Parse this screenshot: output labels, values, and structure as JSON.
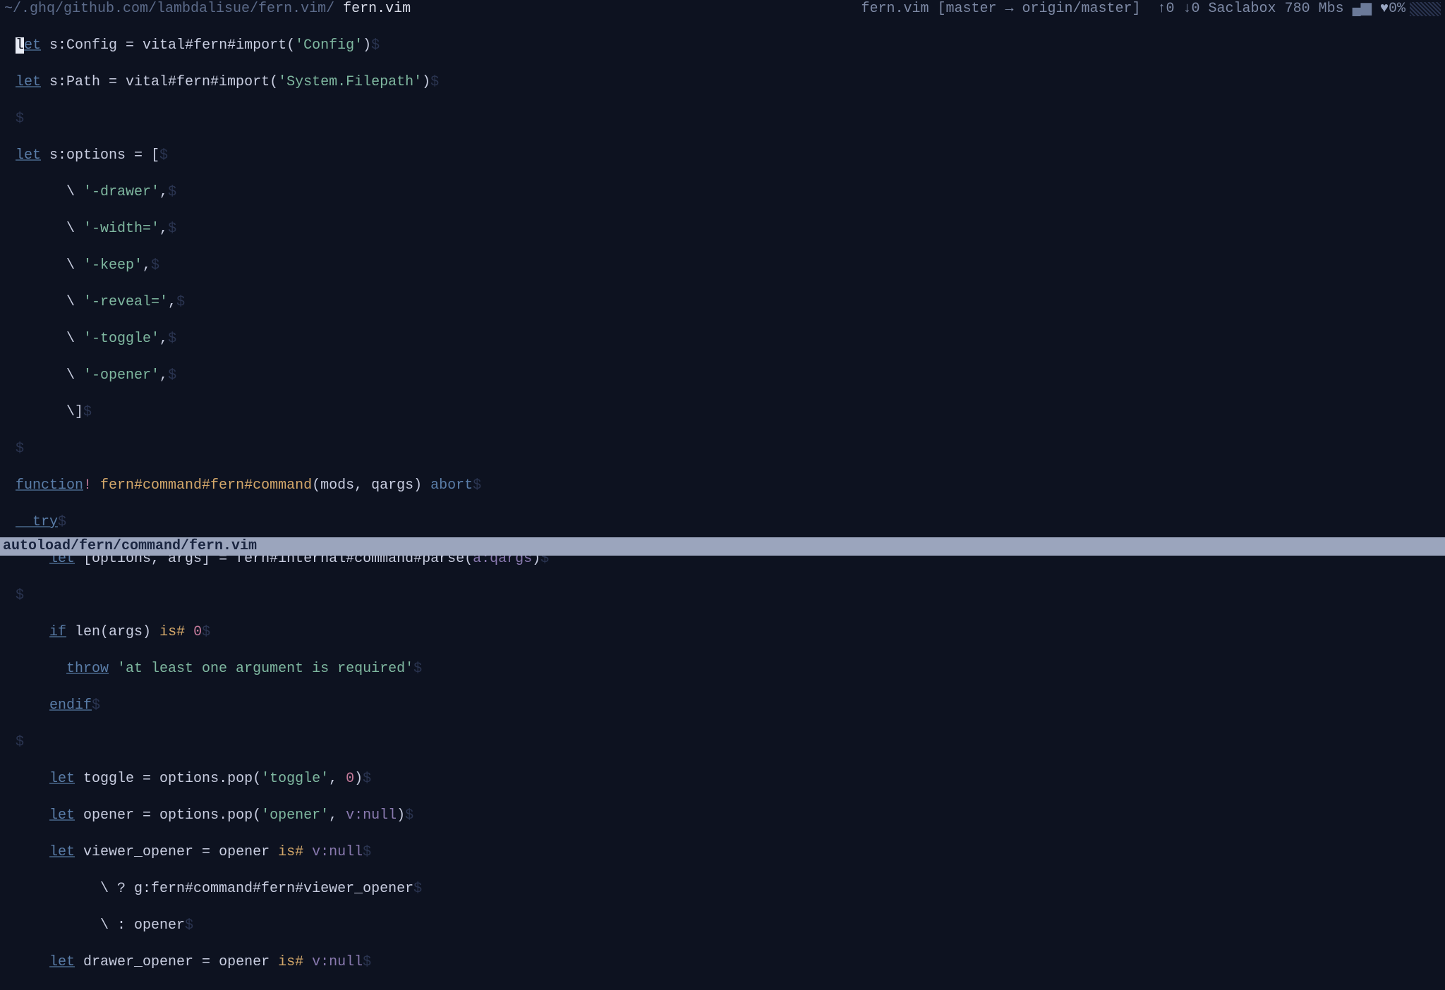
{
  "titlebar": {
    "path": "~/.ghq/github.com/lambdalisue/fern.vim/ ",
    "file": "fern.vim",
    "branch": "fern.vim [master → origin/master]",
    "arrows": "  ↑0 ↓0 ",
    "host": "Saclabox ",
    "net": "780 Mbs ",
    "signal_glyph": "▄▆",
    "heart": " ♥",
    "pct": "0%"
  },
  "eol": "$",
  "code": {
    "l1": {
      "kw": "let",
      "rest": " s:Config = vital#fern#import(",
      "str": "'Config'",
      "close": ")"
    },
    "l2": {
      "kw": "let",
      "rest": " s:Path = vital#fern#import(",
      "str": "'System.Filepath'",
      "close": ")"
    },
    "l4": {
      "kw": "let",
      "rest": " s:options = ["
    },
    "opts": [
      "'-drawer'",
      "'-width='",
      "'-keep'",
      "'-reveal='",
      "'-toggle'",
      "'-opener'"
    ],
    "optPrefix": "      \\ ",
    "optClose": "      \\]",
    "func": {
      "kw": "function",
      "bang": "!",
      "name": " fern#command#fern#command",
      "args": "(mods, qargs) ",
      "abort": "abort"
    },
    "try": "  try",
    "parse": {
      "pre": "    ",
      "kw": "let",
      "rest": " [options, args] = fern#internal#command#parse(",
      "arg": "a:qargs",
      "close": ")"
    },
    "iflen": {
      "pre": "    ",
      "kw": "if",
      "rest": " len(args) ",
      "isop": "is#",
      "num": " 0"
    },
    "throw": {
      "pre": "      ",
      "kw": "throw",
      "str": " 'at least one argument is required'"
    },
    "endif": {
      "pre": "    ",
      "kw": "endif"
    },
    "toggle": {
      "pre": "    ",
      "kw": "let",
      "rest": " toggle = options.pop(",
      "str": "'toggle'",
      "mid": ", ",
      "num": "0",
      "close": ")"
    },
    "opener": {
      "pre": "    ",
      "kw": "let",
      "rest": " opener = options.pop(",
      "str": "'opener'",
      "mid": ", ",
      "val": "v:null",
      "close": ")"
    },
    "vopen": {
      "pre": "    ",
      "kw": "let",
      "rest": " viewer_opener = opener ",
      "isop": "is#",
      "val": " v:null"
    },
    "tern1": "          \\ ? g:fern#command#fern#viewer_opener",
    "tern2": "          \\ : opener",
    "dopen": {
      "pre": "    ",
      "kw": "let",
      "rest": " drawer_opener = opener ",
      "isop": "is#",
      "val": " v:null"
    }
  },
  "status": {
    "text": "autoload/fern/command/fern.vim"
  }
}
